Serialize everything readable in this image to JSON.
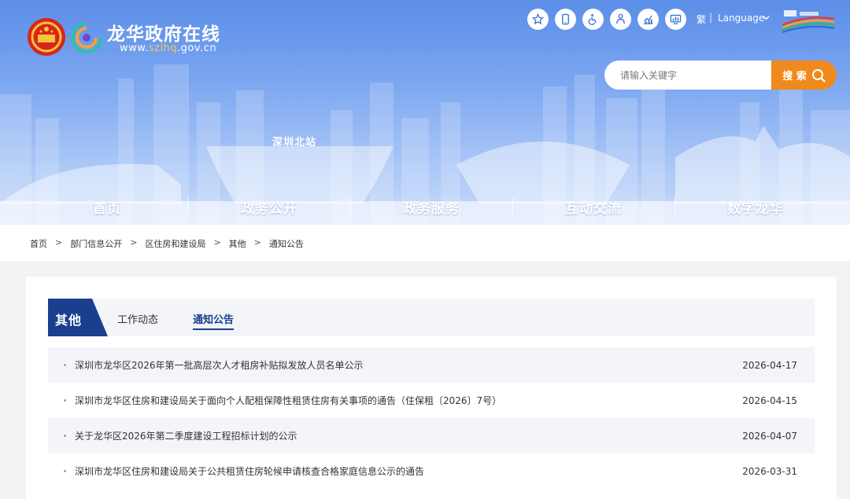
{
  "header": {
    "site_title": "龙华政府在线",
    "url_prefix": "www.",
    "url_highlight": "szlhq",
    "url_suffix": ".gov.cn",
    "station_sign": "深圳北站",
    "lang_traditional": "繁",
    "lang_separator": "|",
    "language_label": "Language",
    "tool_icons": [
      "star-icon",
      "mobile-icon",
      "accessibility-icon",
      "elderly-icon",
      "statistics-icon",
      "data-screen-icon"
    ]
  },
  "search": {
    "placeholder": "请输入关键字",
    "button_label": "搜 索"
  },
  "nav": {
    "items": [
      "首页",
      "政务公开",
      "政务服务",
      "互动交流",
      "数字龙华"
    ]
  },
  "breadcrumb": {
    "items": [
      "首页",
      "部门信息公开",
      "区住房和建设局",
      "其他",
      "通知公告"
    ],
    "separator": ">"
  },
  "tabs": {
    "section_label": "其他",
    "items": [
      "工作动态",
      "通知公告"
    ],
    "active": "通知公告"
  },
  "list": [
    {
      "title": "深圳市龙华区2026年第一批高层次人才租房补贴拟发放人员名单公示",
      "date": "2026-04-17"
    },
    {
      "title": "深圳市龙华区住房和建设局关于面向个人配租保障性租赁住房有关事项的通告（住保租〔2026〕7号）",
      "date": "2026-04-15"
    },
    {
      "title": "关于龙华区2026年第二季度建设工程招标计划的公示",
      "date": "2026-04-07"
    },
    {
      "title": "深圳市龙华区住房和建设局关于公共租赁住房轮候申请核查合格家庭信息公示的通告",
      "date": "2026-03-31"
    }
  ],
  "colors": {
    "banner_top": "#5b8ee8",
    "accent_orange": "#f08a1c",
    "tab_navy": "#1a3f8f",
    "row_stripe": "#f3f5f8"
  }
}
